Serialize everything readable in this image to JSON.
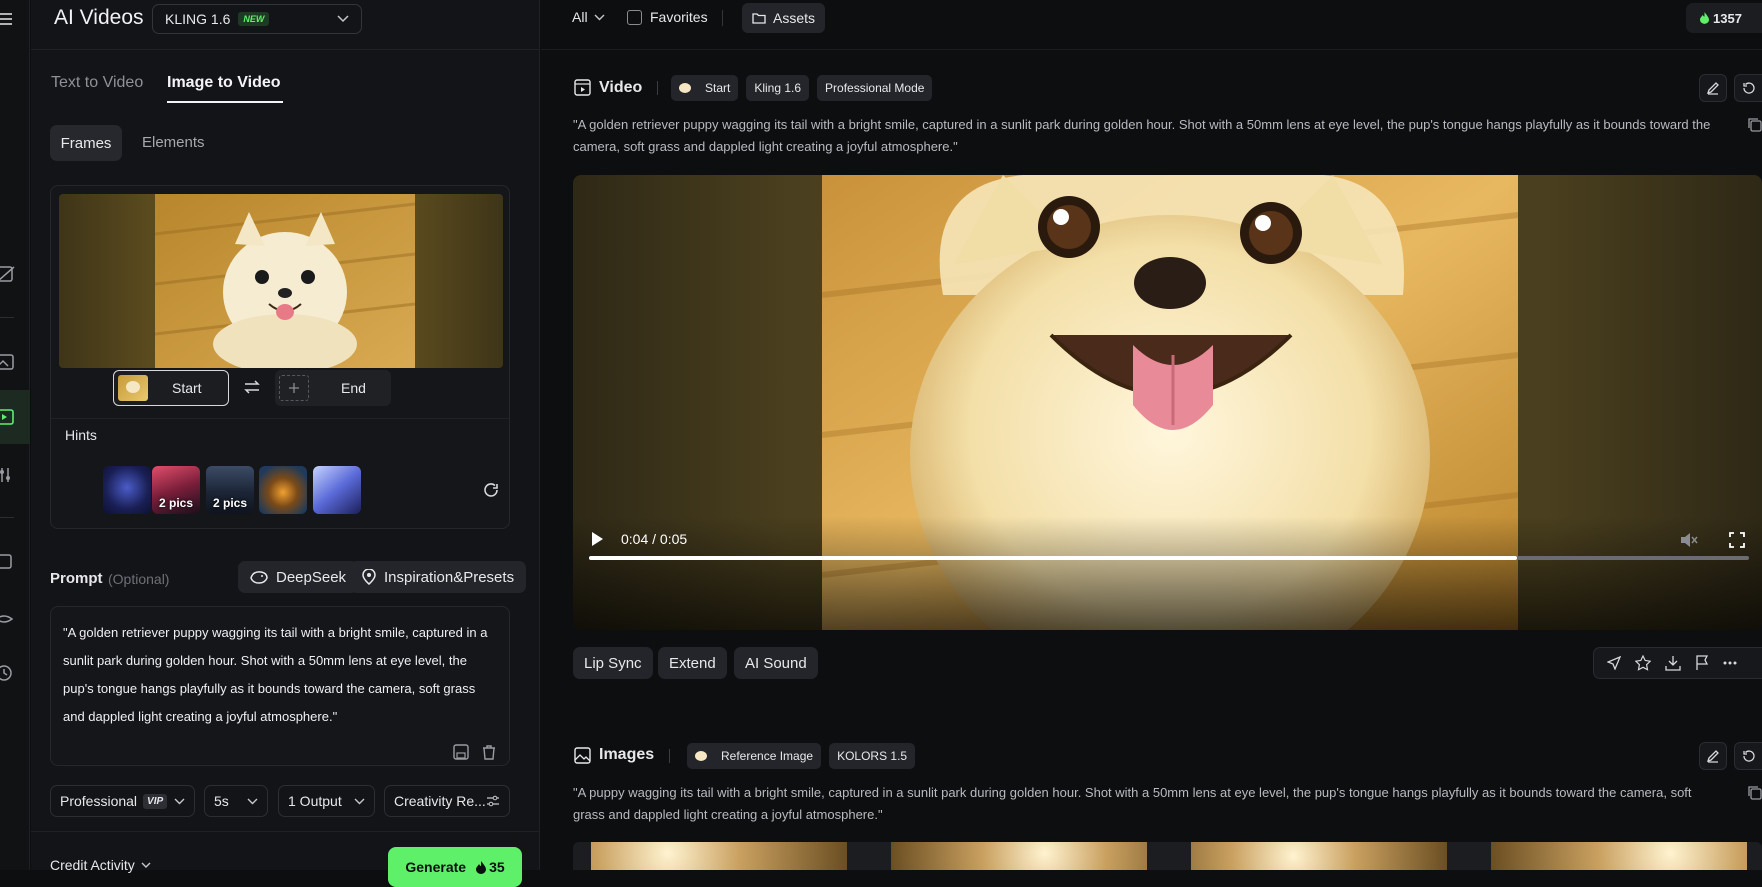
{
  "app": {
    "title": "AI Videos",
    "model": "KLING 1.6",
    "model_badge": "NEW"
  },
  "mode_tabs": [
    {
      "label": "Text to Video"
    },
    {
      "label": "Image to Video"
    }
  ],
  "subtabs": [
    {
      "label": "Frames"
    },
    {
      "label": "Elements"
    }
  ],
  "frames": {
    "start_label": "Start",
    "end_label": "End"
  },
  "hints": {
    "label": "Hints",
    "badges": [
      "2 pics",
      "2 pics"
    ]
  },
  "prompt": {
    "title": "Prompt",
    "optional": "(Optional)",
    "deepseek": "DeepSeek",
    "inspiration": "Inspiration&Presets",
    "text": "\"A golden retriever puppy wagging its tail with a bright smile, captured in a sunlit park during golden hour. Shot with a 50mm lens at eye level, the pup's tongue hangs playfully as it bounds toward the camera, soft grass and dappled light creating a joyful atmosphere.\""
  },
  "settings": {
    "mode": "Professional",
    "vip": "VIP",
    "duration": "5s",
    "outputs": "1 Output",
    "creativity": "Creativity Re..."
  },
  "footer": {
    "credit_activity": "Credit Activity",
    "generate": "Generate",
    "cost": "35"
  },
  "topbar": {
    "filter": "All",
    "favorites": "Favorites",
    "assets": "Assets",
    "credits": "1357"
  },
  "video_section": {
    "title": "Video",
    "tags": [
      "Start",
      "Kling 1.6",
      "Professional Mode"
    ],
    "description": "\"A golden retriever puppy wagging its tail with a bright smile, captured in a sunlit park during golden hour. Shot with a 50mm lens at eye level, the pup's tongue hangs playfully as it bounds toward the camera, soft grass and dappled light creating a joyful atmosphere.\"",
    "time": "0:04 / 0:05",
    "progress": 0.8,
    "actions": [
      "Lip Sync",
      "Extend",
      "AI Sound"
    ]
  },
  "images_section": {
    "title": "Images",
    "tags": [
      "Reference Image",
      "KOLORS 1.5"
    ],
    "description": "\"A puppy wagging its tail with a bright smile, captured in a sunlit park during golden hour. Shot with a 50mm lens at eye level, the pup's tongue hangs playfully as it bounds toward the camera, soft grass and dappled light creating a joyful atmosphere.\""
  },
  "colors": {
    "accent": "#5ff06a",
    "panel": "#131417",
    "bg": "#0d0e10"
  }
}
